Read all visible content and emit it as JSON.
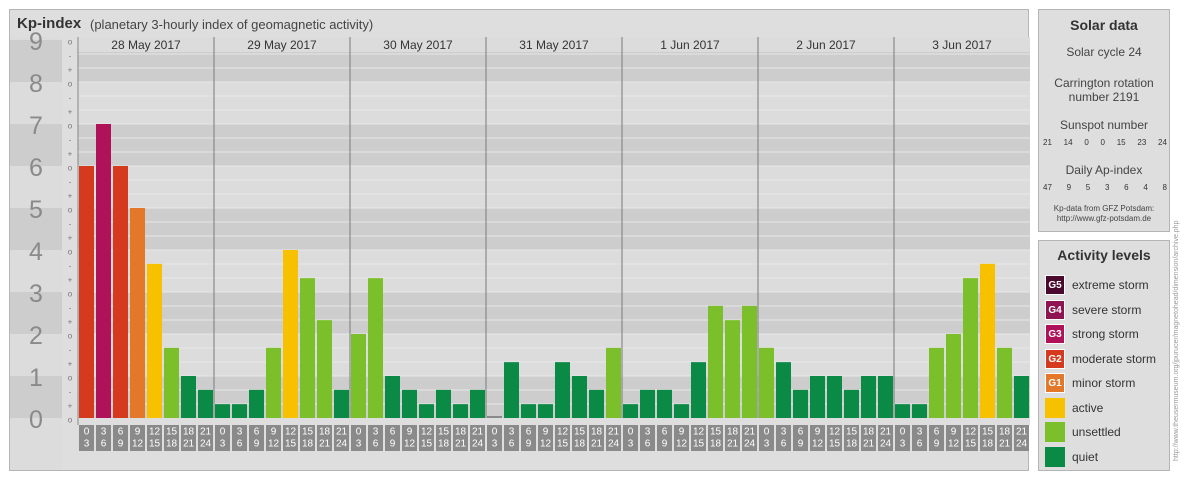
{
  "title": {
    "main": "Kp-index",
    "sub": "(planetary 3-hourly index of geomagnetic activity)"
  },
  "colors": {
    "extreme": "#4a0a2e",
    "severe": "#8e1552",
    "strong": "#b0125a",
    "moderate": "#d63a1e",
    "minor": "#e3782a",
    "active": "#f8c100",
    "unsettled": "#7bbf2a",
    "quiet": "#0a8a45",
    "zero": "#8a8a8a"
  },
  "chart_data": {
    "type": "bar",
    "title": "Kp-index",
    "ylim": [
      0,
      9
    ],
    "y_ticks": [
      "0",
      "1",
      "2",
      "3",
      "4",
      "5",
      "6",
      "7",
      "8",
      "9"
    ],
    "minor_ticks": [
      "o",
      "+",
      "-",
      "o",
      "+",
      "-",
      "o",
      "+",
      "-",
      "o",
      "+",
      "-",
      "o",
      "+",
      "-",
      "o",
      "+",
      "-",
      "o",
      "+",
      "-",
      "o",
      "+",
      "-",
      "o",
      "+",
      "-",
      "o"
    ],
    "days": [
      "28 May 2017",
      "29 May 2017",
      "30 May 2017",
      "31 May 2017",
      "1 Jun 2017",
      "2 Jun 2017",
      "3 Jun 2017"
    ],
    "interval_start": [
      "0",
      "3",
      "6",
      "9",
      "12",
      "15",
      "18",
      "21"
    ],
    "interval_end": [
      "3",
      "6",
      "9",
      "12",
      "15",
      "18",
      "21",
      "24"
    ],
    "values": [
      [
        6.0,
        7.0,
        6.0,
        5.0,
        3.67,
        1.67,
        1.0,
        0.67
      ],
      [
        0.33,
        0.33,
        0.67,
        1.67,
        4.0,
        3.33,
        2.33,
        0.67
      ],
      [
        2.0,
        3.33,
        1.0,
        0.67,
        0.33,
        0.67,
        0.33,
        0.67
      ],
      [
        0.0,
        1.33,
        0.33,
        0.33,
        1.33,
        1.0,
        0.67,
        1.67
      ],
      [
        0.33,
        0.67,
        0.67,
        0.33,
        1.33,
        2.67,
        2.33,
        2.67
      ],
      [
        1.67,
        1.33,
        0.67,
        1.0,
        1.0,
        0.67,
        1.0,
        1.0
      ],
      [
        0.33,
        0.33,
        1.67,
        2.0,
        3.33,
        3.67,
        1.67,
        1.0
      ]
    ]
  },
  "solar": {
    "title": "Solar data",
    "cycle": "Solar cycle 24",
    "carrington_line1": "Carrington rotation",
    "carrington_line2": "number 2191",
    "sunspot_label": "Sunspot number",
    "sunspot_values": [
      "21",
      "14",
      "0",
      "0",
      "15",
      "23",
      "24"
    ],
    "ap_label": "Daily Ap-index",
    "ap_values": [
      "47",
      "9",
      "5",
      "3",
      "6",
      "4",
      "8"
    ],
    "source_line1": "Kp-data from GFZ Potsdam:",
    "source_line2": "http://www.gfz-potsdam.de"
  },
  "activity": {
    "title": "Activity levels",
    "items": [
      {
        "badge": "G5",
        "label": "extreme storm",
        "color_key": "extreme"
      },
      {
        "badge": "G4",
        "label": "severe storm",
        "color_key": "severe"
      },
      {
        "badge": "G3",
        "label": "strong storm",
        "color_key": "strong"
      },
      {
        "badge": "G2",
        "label": "moderate storm",
        "color_key": "moderate"
      },
      {
        "badge": "G1",
        "label": "minor storm",
        "color_key": "minor"
      },
      {
        "badge": "",
        "label": "active",
        "color_key": "active"
      },
      {
        "badge": "",
        "label": "unsettled",
        "color_key": "unsettled"
      },
      {
        "badge": "",
        "label": "quiet",
        "color_key": "quiet"
      }
    ]
  },
  "watermark": "http://www.theusermuseum.org/jpurucer/magnetohead/dimension/archive.php"
}
